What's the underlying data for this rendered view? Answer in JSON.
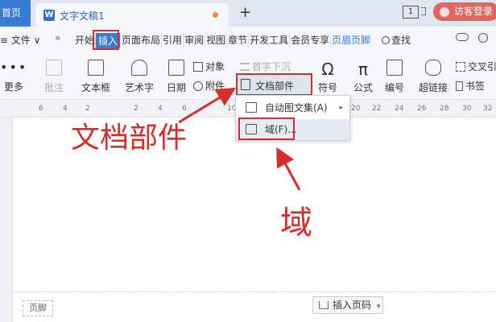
{
  "titlebar": {
    "home_tab": "首页",
    "doc_tab": "文字文稿1",
    "doc_icon": "W",
    "new_tab": "+",
    "page_count": "1",
    "guest_login": "访客登录"
  },
  "menubar": {
    "file": "≡ 文件 ∨",
    "more": "»",
    "tabs": [
      "开始",
      "插入",
      "页面布局",
      "引用",
      "审阅",
      "视图",
      "章节",
      "开发工具",
      "会员专享",
      "页眉页脚"
    ],
    "active_tab": "插入",
    "search": "查找"
  },
  "ribbon": {
    "more": "更多",
    "comment": "批注",
    "textbox": "文本框",
    "wordart": "艺术字",
    "date": "日期",
    "object": "对象",
    "attachment": "附件",
    "dropcap": "首字下沉",
    "docparts": "文档部件",
    "symbol": "符号",
    "formula": "公式",
    "numbering": "编号",
    "hyperlink": "超链接",
    "crossref": "交叉引",
    "bookmark": "书签"
  },
  "ruler": {
    "ticks": [
      "6",
      "4",
      "2",
      "2",
      "4",
      "6",
      "10",
      "20",
      "22",
      "24",
      "26",
      "28",
      "30",
      "32"
    ]
  },
  "dropdown": {
    "items": [
      {
        "label": "自动图文集(A)",
        "has_submenu": true
      },
      {
        "label": "域(F)...",
        "has_submenu": false
      }
    ]
  },
  "annotations": {
    "docparts_callout": "文档部件",
    "field_callout": "域",
    "accent_color": "#d62d2d"
  },
  "footer": {
    "footer_label": "页脚",
    "insert_page_number": "插入页码"
  }
}
